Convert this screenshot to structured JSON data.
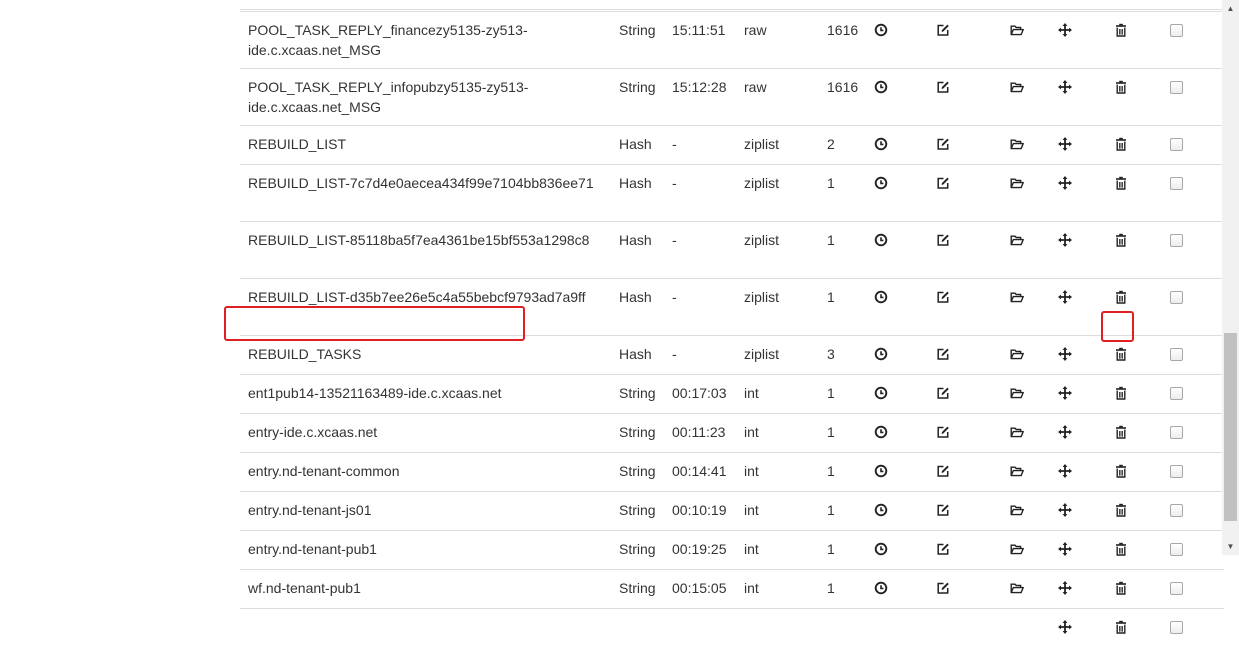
{
  "rows": [
    {
      "key": "",
      "type": "",
      "ttl": "",
      "encoding": "",
      "size": "",
      "partial": true
    },
    {
      "key": "POOL_TASK_REPLY_financezy5135-zy513-ide.c.xcaas.net_MSG",
      "type": "String",
      "ttl": "15:11:51",
      "encoding": "raw",
      "size": "1616"
    },
    {
      "key": "POOL_TASK_REPLY_infopubzy5135-zy513-ide.c.xcaas.net_MSG",
      "type": "String",
      "ttl": "15:12:28",
      "encoding": "raw",
      "size": "1616"
    },
    {
      "key": "REBUILD_LIST",
      "type": "Hash",
      "ttl": "-",
      "encoding": "ziplist",
      "size": "2"
    },
    {
      "key": "REBUILD_LIST-7c7d4e0aecea434f99e7104bb836ee71",
      "type": "Hash",
      "ttl": "-",
      "encoding": "ziplist",
      "size": "1"
    },
    {
      "key": "REBUILD_LIST-85118ba5f7ea4361be15bf553a1298c8",
      "type": "Hash",
      "ttl": "-",
      "encoding": "ziplist",
      "size": "1"
    },
    {
      "key": "REBUILD_LIST-d35b7ee26e5c4a55bebcf9793ad7a9ff",
      "type": "Hash",
      "ttl": "-",
      "encoding": "ziplist",
      "size": "1"
    },
    {
      "key": "REBUILD_TASKS",
      "type": "Hash",
      "ttl": "-",
      "encoding": "ziplist",
      "size": "3"
    },
    {
      "key": "ent1pub14-13521163489-ide.c.xcaas.net",
      "type": "String",
      "ttl": "00:17:03",
      "encoding": "int",
      "size": "1"
    },
    {
      "key": "entry-ide.c.xcaas.net",
      "type": "String",
      "ttl": "00:11:23",
      "encoding": "int",
      "size": "1"
    },
    {
      "key": "entry.nd-tenant-common",
      "type": "String",
      "ttl": "00:14:41",
      "encoding": "int",
      "size": "1"
    },
    {
      "key": "entry.nd-tenant-js01",
      "type": "String",
      "ttl": "00:10:19",
      "encoding": "int",
      "size": "1"
    },
    {
      "key": "entry.nd-tenant-pub1",
      "type": "String",
      "ttl": "00:19:25",
      "encoding": "int",
      "size": "1"
    },
    {
      "key": "wf.nd-tenant-pub1",
      "type": "String",
      "ttl": "00:15:05",
      "encoding": "int",
      "size": "1"
    }
  ],
  "footer_actions": [
    "move-icon",
    "trash-icon",
    "checkbox"
  ],
  "row_icons": [
    "clock-icon",
    "edit-icon",
    "folder-open-icon",
    "move-icon",
    "trash-icon"
  ],
  "colors": {
    "highlight": "#e02020",
    "icon": "#222222",
    "border": "#dddddd"
  }
}
